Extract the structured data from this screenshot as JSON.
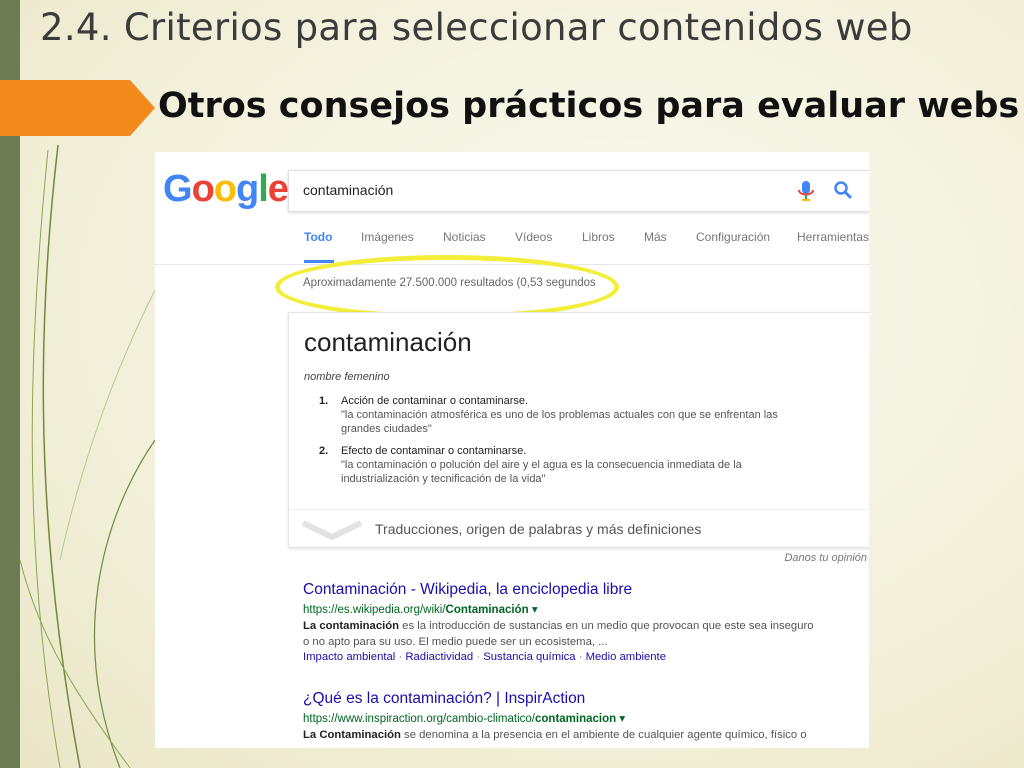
{
  "slide": {
    "title": "2.4. Criterios para seleccionar contenidos web",
    "subtitle": "Otros consejos prácticos para evaluar webs"
  },
  "colors": {
    "side_bar": "#6b7b52",
    "arrow": "#f28a1e",
    "highlight": "#f3ee3a",
    "link": "#1a0dab",
    "url": "#006621",
    "tab_active": "#4285f4"
  },
  "google": {
    "logo_letters": [
      "G",
      "o",
      "o",
      "g",
      "l",
      "e"
    ],
    "logo_colors": [
      "#4285f4",
      "#ea4335",
      "#fbbc05",
      "#4285f4",
      "#34a853",
      "#ea4335"
    ],
    "search_query": "contaminación",
    "icons": {
      "mic": "microphone-icon",
      "search": "search-icon"
    },
    "tabs": [
      "Todo",
      "Imágenes",
      "Noticias",
      "Vídeos",
      "Libros",
      "Más",
      "Configuración",
      "Herramientas"
    ],
    "active_tab": "Todo",
    "results_count": "Aproximadamente 27.500.000 resultados (0,53 segundos"
  },
  "dictionary": {
    "word": "contaminación",
    "part_of_speech": "nombre femenino",
    "definitions": [
      {
        "num": "1.",
        "text": "Acción de contaminar o contaminarse.",
        "example_line1": "\"la contaminación atmosférica es uno de los problemas actuales con que se enfrentan las",
        "example_line2": "grandes ciudades\""
      },
      {
        "num": "2.",
        "text": "Efecto de contaminar o contaminarse.",
        "example_line1": "\"la contaminación o polución del aire y el agua es la consecuencia inmediata de la",
        "example_line2": "industrialización y tecnificación de la vida\""
      }
    ],
    "more": "Traducciones, origen de palabras y más definiciones"
  },
  "feedback": "Danos tu opinión",
  "results": [
    {
      "title": "Contaminación - Wikipedia, la enciclopedia libre",
      "url_prefix": "https://es.wikipedia.org/wiki/",
      "url_bold": "Contaminación",
      "snippet_bold": "La contaminación",
      "snippet_line1": " es la introducción de sustancias en un medio que provocan que este sea inseguro",
      "snippet_line2": "o no apto para su uso. El medio puede ser un ecosistema, ...",
      "links": [
        "Impacto ambiental",
        "Radiactividad",
        "Sustancia química",
        "Medio ambiente"
      ]
    },
    {
      "title": "¿Qué es la contaminación? | InspirAction",
      "url_prefix": "https://www.inspiraction.org/cambio-climatico/",
      "url_bold": "contaminacion",
      "snippet_bold": "La Contaminación",
      "snippet_line1": " se denomina a la presencia en el ambiente de cualquier agente químico, físico o"
    }
  ]
}
